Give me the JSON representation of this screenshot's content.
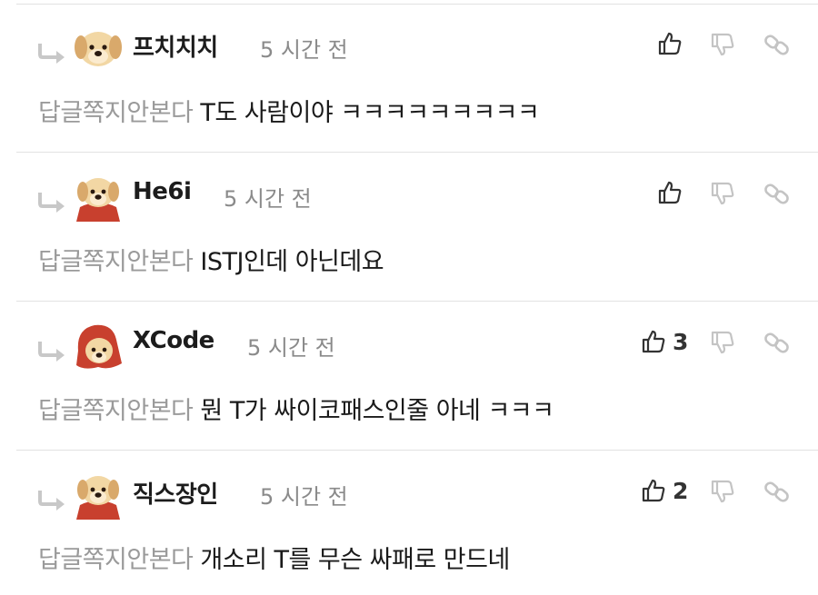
{
  "comments": [
    {
      "nickname": "프치치치",
      "time": "5 시간 전",
      "quote": "답글쪽지안본다",
      "text": "T도 사람이야 ㅋㅋㅋㅋㅋㅋㅋㅋㅋ",
      "likes": "",
      "avatar": "puppy"
    },
    {
      "nickname": "He6i",
      "time": "5 시간 전",
      "quote": "답글쪽지안본다",
      "text": "ISTJ인데 아닌데요",
      "likes": "",
      "avatar": "puppy-red-cape"
    },
    {
      "nickname": "XCode",
      "time": "5 시간 전",
      "quote": "답글쪽지안본다",
      "text": "뭔 T가 싸이코패스인줄 아네 ㅋㅋㅋ",
      "likes": "3",
      "avatar": "puppy-red-hood"
    },
    {
      "nickname": "직스장인",
      "time": "5 시간 전",
      "quote": "답글쪽지안본다",
      "text": "개소리 T를 무슨 싸패로 만드네",
      "likes": "2",
      "avatar": "puppy-red-cape"
    }
  ],
  "icons": {
    "reply": "reply-arrow-icon",
    "like": "thumbs-up-icon",
    "dislike": "thumbs-down-icon",
    "link": "link-icon"
  },
  "colors": {
    "cape": "#c8402e",
    "fur": "#f2d7a4",
    "muted": "#9a9a9a"
  }
}
